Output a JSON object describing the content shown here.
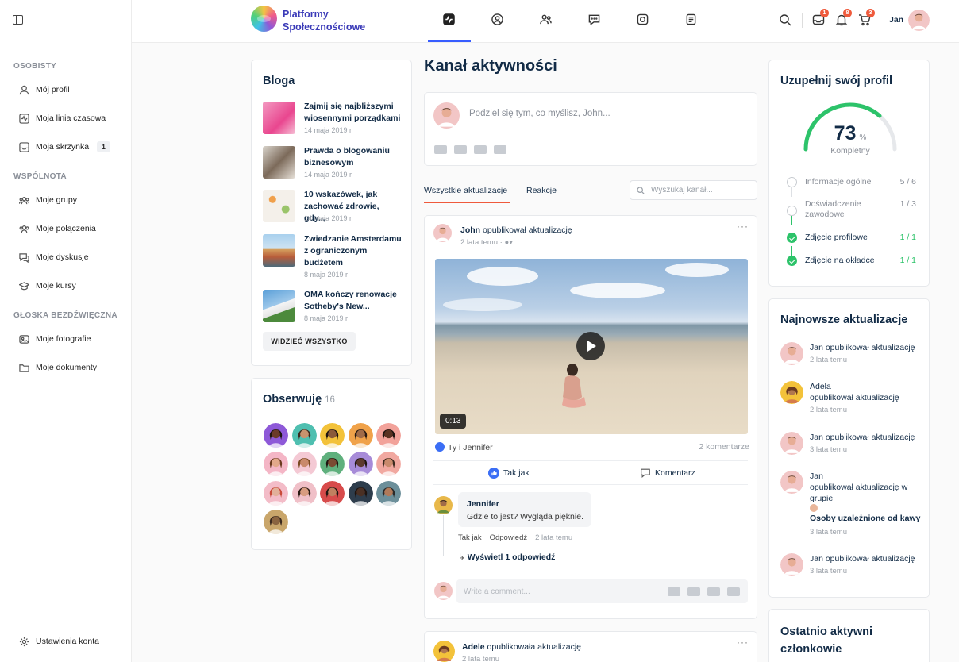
{
  "colors": {
    "accent": "#385dff",
    "tab_underline": "#ef5a3c",
    "done_green": "#2dc36a",
    "brand": "#3b3bb8"
  },
  "sidebar": {
    "sections": [
      {
        "title": "OSOBISTY",
        "items": [
          {
            "label": "Mój profil",
            "icon": "user-icon"
          },
          {
            "label": "Moja linia czasowa",
            "icon": "activity-icon"
          },
          {
            "label": "Moja skrzynka",
            "icon": "inbox-icon",
            "badge": "1"
          }
        ]
      },
      {
        "title": "WSPÓLNOTA",
        "items": [
          {
            "label": "Moje grupy",
            "icon": "groups-icon"
          },
          {
            "label": "Moje połączenia",
            "icon": "connections-icon"
          },
          {
            "label": "Moje dyskusje",
            "icon": "discussion-icon"
          },
          {
            "label": "Moje kursy",
            "icon": "graduation-cap-icon"
          }
        ]
      },
      {
        "title": "GŁOSKA BEZDŹWIĘCZNA",
        "items": [
          {
            "label": "Moje fotografie",
            "icon": "photo-icon"
          },
          {
            "label": "Moje dokumenty",
            "icon": "folder-icon"
          }
        ]
      }
    ],
    "footer": {
      "label": "Ustawienia konta",
      "icon": "gear-icon"
    }
  },
  "header": {
    "brand_line1": "Platformy",
    "brand_line2": "Społecznościowe",
    "nav": [
      "activity-icon",
      "profile-icon",
      "members-icon",
      "forums-icon",
      "photos-icon",
      "documents-icon"
    ],
    "badges": {
      "messages": "1",
      "notifications": "8",
      "cart": "3"
    },
    "user_name": "Jan"
  },
  "blog": {
    "title": "Bloga",
    "posts": [
      {
        "title": "Zajmij się najbliższymi wiosennymi porządkami",
        "date": "14 maja 2019 r"
      },
      {
        "title": "Prawda o blogowaniu biznesowym",
        "date": "14 maja 2019 r"
      },
      {
        "title": "10 wskazówek, jak zachować zdrowie, gdy...",
        "date": "14 maja 2019 r"
      },
      {
        "title": "Zwiedzanie Amsterdamu z ograniczonym budżetem",
        "date": "8 maja 2019 r"
      },
      {
        "title": "OMA kończy renowację Sotheby's New...",
        "date": "8 maja 2019 r"
      }
    ],
    "see_all": "WIDZIEĆ WSZYSTKO"
  },
  "following": {
    "title": "Obserwuję",
    "count": "16"
  },
  "feed": {
    "title": "Kanał aktywności",
    "composer_placeholder": "Podziel się tym, co myślisz, John...",
    "tabs": [
      "Wszystkie aktualizacje",
      "Reakcje"
    ],
    "search_placeholder": "Wyszukaj kanał...",
    "post1": {
      "author": "John",
      "action": "opublikował aktualizację",
      "time": "2 lata temu",
      "duration": "0:13",
      "reactions": "Ty i Jennifer",
      "comment_count": "2 komentarze",
      "like_label": "Tak jak",
      "comment_label": "Komentarz",
      "comment": {
        "name": "Jennifer",
        "text": "Gdzie to jest? Wygląda pięknie.",
        "like": "Tak jak",
        "reply": "Odpowiedź",
        "time": "2 lata temu"
      },
      "view_replies": "Wyświetl 1 odpowiedź",
      "write_placeholder": "Write a comment..."
    },
    "post2": {
      "author": "Adele",
      "action": "opublikowała aktualizację",
      "time": "2 lata temu"
    }
  },
  "profile_complete": {
    "title": "Uzupełnij swój profil",
    "percent": 73,
    "percent_sign": "%",
    "label": "Kompletny",
    "steps": [
      {
        "label": "Informacje ogólne",
        "value": "5 / 6",
        "done": false
      },
      {
        "label": "Doświadczenie zawodowe",
        "value": "1 / 3",
        "done": false
      },
      {
        "label": "Zdjęcie profilowe",
        "value": "1 / 1",
        "done": true
      },
      {
        "label": "Zdjęcie na okładce",
        "value": "1 / 1",
        "done": true
      }
    ]
  },
  "latest_updates": {
    "title": "Najnowsze aktualizacje",
    "items": [
      {
        "text": "Jan opublikował aktualizację",
        "time": "2 lata temu"
      },
      {
        "text": "Adela",
        "text2": "opublikował aktualizację",
        "time": "2 lata temu"
      },
      {
        "text": "Jan opublikował aktualizację",
        "time": "3 lata temu"
      },
      {
        "text": "Jan",
        "text2": "opublikował aktualizację w grupie",
        "group": "Osoby uzależnione od kawy",
        "time": "3 lata temu"
      },
      {
        "text": "Jan opublikował aktualizację",
        "time": "3 lata temu"
      }
    ]
  },
  "recently_active": {
    "title_line1": "Ostatnio aktywni",
    "title_line2": "członkowie"
  }
}
